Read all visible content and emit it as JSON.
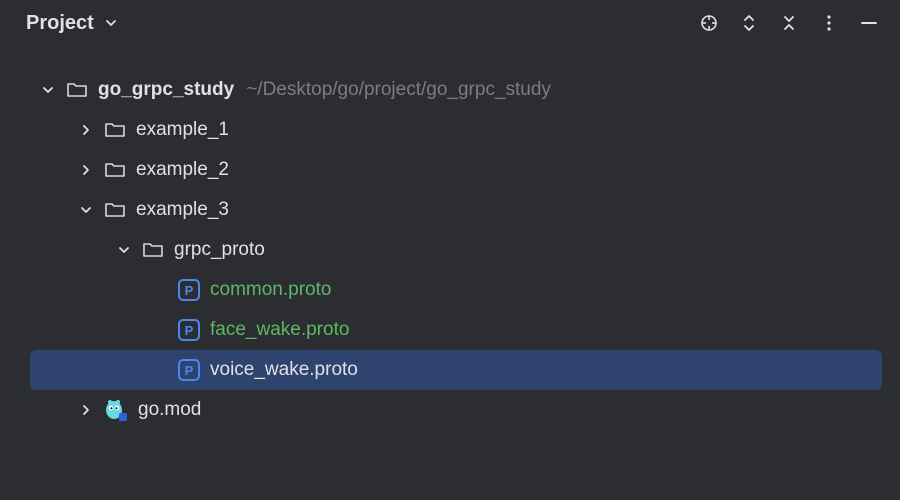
{
  "header": {
    "title": "Project"
  },
  "tree": {
    "root": {
      "name": "go_grpc_study",
      "path": "~/Desktop/go/project/go_grpc_study"
    },
    "example1": "example_1",
    "example2": "example_2",
    "example3": "example_3",
    "grpc_proto": "grpc_proto",
    "common_proto": "common.proto",
    "face_wake_proto": "face_wake.proto",
    "voice_wake_proto": "voice_wake.proto",
    "go_mod": "go.mod"
  }
}
